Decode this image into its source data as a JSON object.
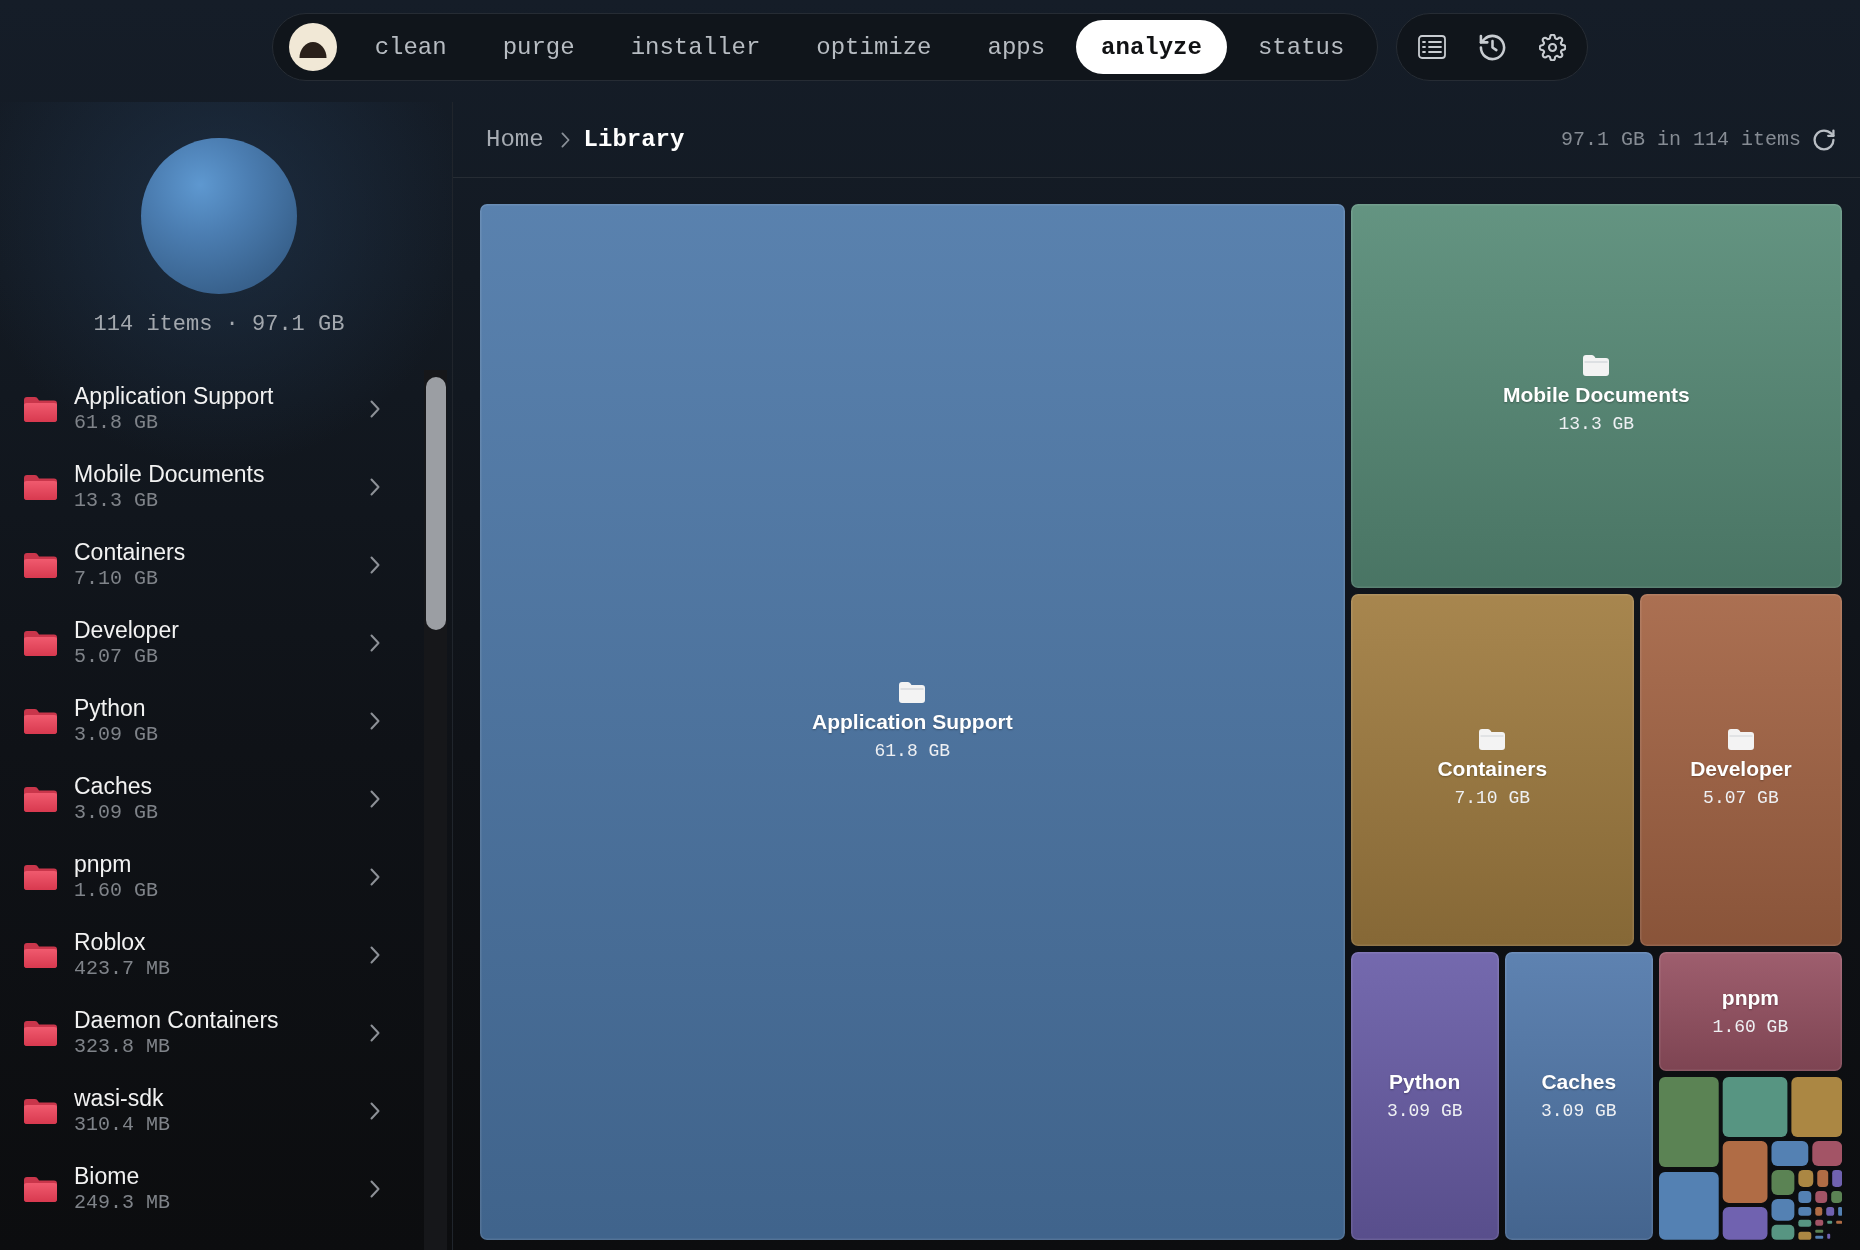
{
  "nav": {
    "tabs": [
      {
        "label": "clean",
        "selected": false
      },
      {
        "label": "purge",
        "selected": false
      },
      {
        "label": "installer",
        "selected": false
      },
      {
        "label": "optimize",
        "selected": false
      },
      {
        "label": "apps",
        "selected": false
      },
      {
        "label": "analyze",
        "selected": true
      },
      {
        "label": "status",
        "selected": false
      }
    ]
  },
  "sidebar": {
    "summary": "114 items · 97.1 GB",
    "items": [
      {
        "name": "Application Support",
        "size": "61.8 GB"
      },
      {
        "name": "Mobile Documents",
        "size": "13.3 GB"
      },
      {
        "name": "Containers",
        "size": "7.10 GB"
      },
      {
        "name": "Developer",
        "size": "5.07 GB"
      },
      {
        "name": "Python",
        "size": "3.09 GB"
      },
      {
        "name": "Caches",
        "size": "3.09 GB"
      },
      {
        "name": "pnpm",
        "size": "1.60 GB"
      },
      {
        "name": "Roblox",
        "size": "423.7 MB"
      },
      {
        "name": "Daemon Containers",
        "size": "323.8 MB"
      },
      {
        "name": "wasi-sdk",
        "size": "310.4 MB"
      },
      {
        "name": "Biome",
        "size": "249.3 MB"
      }
    ]
  },
  "breadcrumb": [
    {
      "label": "Home",
      "current": false
    },
    {
      "label": "Library",
      "current": true
    }
  ],
  "header_summary": "97.1 GB in 114 items",
  "treemap": {
    "tiles": [
      {
        "name": "Application Support",
        "size": "61.8 GB",
        "color": "#4d78a8",
        "icon": true
      },
      {
        "name": "Mobile Documents",
        "size": "13.3 GB",
        "color": "#588c78",
        "icon": true
      },
      {
        "name": "Containers",
        "size": "7.10 GB",
        "color": "#a17d41",
        "icon": true
      },
      {
        "name": "Developer",
        "size": "5.07 GB",
        "color": "#a56545",
        "icon": true
      },
      {
        "name": "Python",
        "size": "3.09 GB",
        "color": "#6a5ea8",
        "icon": false
      },
      {
        "name": "Caches",
        "size": "3.09 GB",
        "color": "#5279ab",
        "icon": false
      },
      {
        "name": "pnpm",
        "size": "1.60 GB",
        "color": "#975263",
        "icon": false
      }
    ],
    "small_tiles": [
      {
        "color": "#5b8354"
      },
      {
        "color": "#579582"
      },
      {
        "color": "#ab8743"
      },
      {
        "color": "#5481b3"
      },
      {
        "color": "#b06c45"
      },
      {
        "color": "#7062b0"
      },
      {
        "color": "#5481b3"
      },
      {
        "color": "#a35466"
      },
      {
        "color": "#5b8354"
      },
      {
        "color": "#5481b3"
      },
      {
        "color": "#579582"
      },
      {
        "color": "#ab8743"
      },
      {
        "color": "#b06c45"
      },
      {
        "color": "#7062b0"
      },
      {
        "color": "#5481b3"
      },
      {
        "color": "#a35466"
      },
      {
        "color": "#5b8354"
      },
      {
        "color": "#5481b3"
      },
      {
        "color": "#b06c45"
      },
      {
        "color": "#7062b0"
      },
      {
        "color": "#5481b3"
      },
      {
        "color": "#579582"
      },
      {
        "color": "#a35466"
      },
      {
        "color": "#579582"
      },
      {
        "color": "#b06c45"
      },
      {
        "color": "#ab8743"
      },
      {
        "color": "#5b8354"
      },
      {
        "color": "#5481b3"
      },
      {
        "color": "#7062b0"
      }
    ]
  }
}
